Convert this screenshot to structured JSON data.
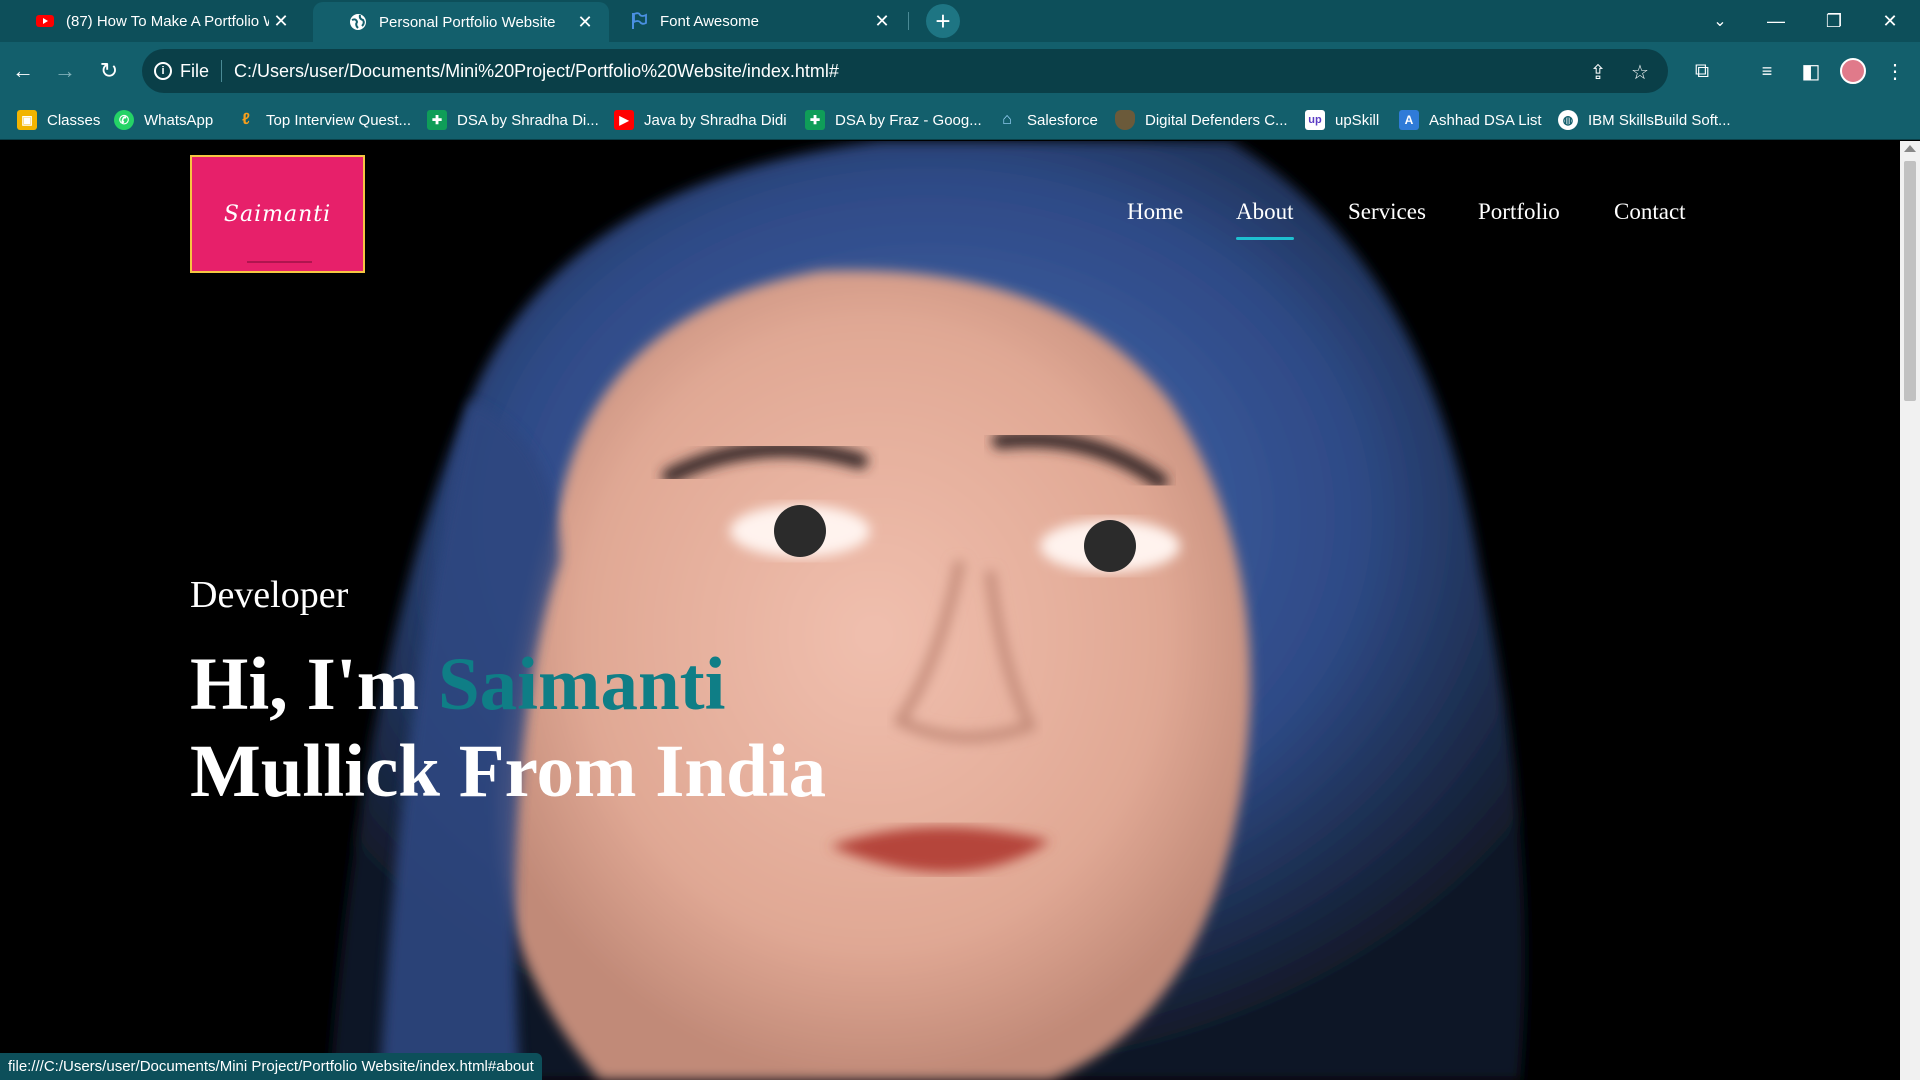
{
  "browser": {
    "tabs": [
      {
        "title": "(87) How To Make A Portfolio W",
        "favicon": "youtube-icon",
        "active": false
      },
      {
        "title": "Personal Portfolio Website",
        "favicon": "globe-icon",
        "active": true
      },
      {
        "title": "Font Awesome",
        "favicon": "flag-icon",
        "active": false
      }
    ],
    "omnibox": {
      "scheme": "File",
      "url": "C:/Users/user/Documents/Mini%20Project/Portfolio%20Website/index.html#"
    },
    "bookmarks": [
      {
        "label": "Classes",
        "icon": "classroom-icon",
        "color": "#f2b400"
      },
      {
        "label": "WhatsApp",
        "icon": "whatsapp-icon",
        "color": "#25d366"
      },
      {
        "label": "Top Interview Quest...",
        "icon": "leetcode-icon",
        "color": "#f89f1b"
      },
      {
        "label": "DSA by Shradha Di...",
        "icon": "sheets-icon",
        "color": "#0f9d58"
      },
      {
        "label": "Java by Shradha Didi",
        "icon": "youtube-icon",
        "color": "#ff0000"
      },
      {
        "label": "DSA by Fraz - Goog...",
        "icon": "sheets-icon",
        "color": "#0f9d58"
      },
      {
        "label": "Salesforce",
        "icon": "salesforce-icon",
        "color": "#00a1e0"
      },
      {
        "label": "Digital Defenders C...",
        "icon": "shield-icon",
        "color": "#6b5a3a"
      },
      {
        "label": "upSkill",
        "icon": "upskill-icon",
        "color": "#5b3cc4"
      },
      {
        "label": "Ashhad DSA List",
        "icon": "a-icon",
        "color": "#2f7bd8"
      },
      {
        "label": "IBM SkillsBuild Soft...",
        "icon": "globe-icon",
        "color": "#ffffff"
      }
    ],
    "status_url": "file:///C:/Users/user/Documents/Mini Project/Portfolio Website/index.html#about"
  },
  "page": {
    "logo_text": "Saimanti",
    "nav": [
      {
        "label": "Home",
        "active": false
      },
      {
        "label": "About",
        "active": true
      },
      {
        "label": "Services",
        "active": false
      },
      {
        "label": "Portfolio",
        "active": false
      },
      {
        "label": "Contact",
        "active": false
      }
    ],
    "role": "Developer",
    "headline": {
      "prefix": "Hi, I'm ",
      "highlight": "Saimanti",
      "line2": "Mullick From India"
    },
    "colors": {
      "accent": "#0f7e86",
      "nav_underline": "#1ec0d0",
      "logo_bg": "#e7206a",
      "logo_border": "#f5c542"
    }
  }
}
